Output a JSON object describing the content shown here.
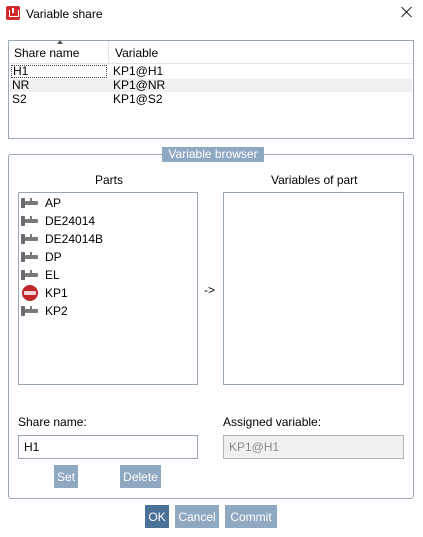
{
  "window": {
    "title": "Variable share",
    "app_icon": "app-logo-icon",
    "close_icon": "close-icon"
  },
  "share_table": {
    "columns": [
      "Share name",
      "Variable"
    ],
    "rows": [
      {
        "share_name": "H1",
        "variable": "KP1@H1"
      },
      {
        "share_name": "NR",
        "variable": "KP1@NR"
      },
      {
        "share_name": "S2",
        "variable": "KP1@S2"
      }
    ]
  },
  "browser": {
    "legend": "Variable browser",
    "parts_label": "Parts",
    "variables_label": "Variables of part",
    "arrow": "->",
    "parts": [
      {
        "label": "AP",
        "icon": "part-icon"
      },
      {
        "label": "DE24014",
        "icon": "part-icon"
      },
      {
        "label": "DE24014B",
        "icon": "part-icon"
      },
      {
        "label": "DP",
        "icon": "part-icon"
      },
      {
        "label": "EL",
        "icon": "part-icon"
      },
      {
        "label": "KP1",
        "icon": "active-part-icon"
      },
      {
        "label": "KP2",
        "icon": "part-icon"
      }
    ],
    "share_name_label": "Share name:",
    "share_name_value": "H1",
    "assigned_variable_label": "Assigned variable:",
    "assigned_variable_value": "KP1@H1",
    "set_label": "Set",
    "delete_label": "Delete"
  },
  "footer": {
    "ok_label": "OK",
    "cancel_label": "Cancel",
    "commit_label": "Commit"
  },
  "colors": {
    "accent": "#8fa9c2",
    "primary": "#4a7196",
    "border": "#9aa7b4",
    "icon_red": "#c0272d"
  }
}
